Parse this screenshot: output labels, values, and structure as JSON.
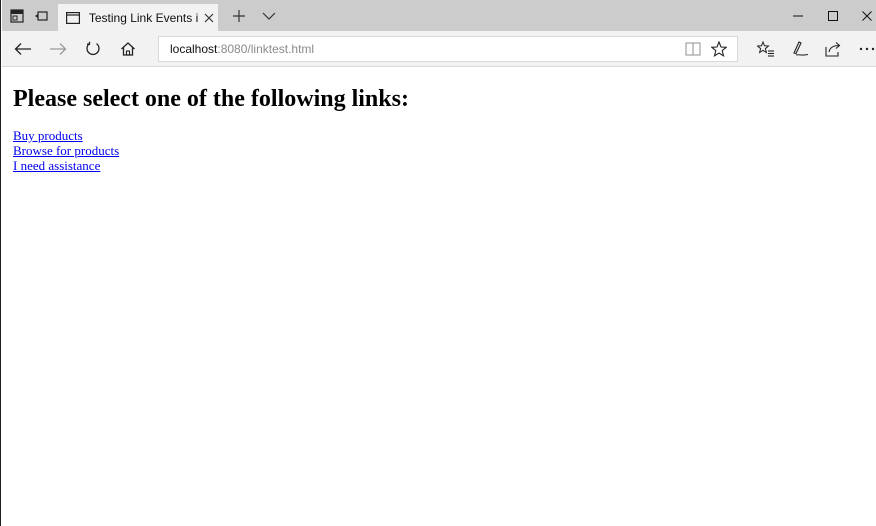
{
  "browser": {
    "tab": {
      "title": "Testing Link Events in Pl"
    },
    "address": {
      "host": "localhost",
      "rest": ":8080/linktest.html"
    }
  },
  "page": {
    "heading": "Please select one of the following links:",
    "links": [
      {
        "label": "Buy products"
      },
      {
        "label": "Browse for products"
      },
      {
        "label": "I need assistance"
      }
    ]
  },
  "colors": {
    "tabstrip": "#cccccc",
    "toolbar": "#f2f2f2",
    "link": "#0000ee"
  },
  "icons": [
    "tab-preview-icon",
    "set-aside-tabs-icon",
    "tab-page-icon",
    "close-icon",
    "plus-icon",
    "chevron-down-icon",
    "minimize-icon",
    "maximize-icon",
    "close-window-icon",
    "back-arrow-icon",
    "forward-arrow-icon",
    "refresh-icon",
    "home-icon",
    "reading-view-icon",
    "star-icon",
    "favorites-hub-icon",
    "pen-icon",
    "share-icon",
    "more-icon"
  ]
}
